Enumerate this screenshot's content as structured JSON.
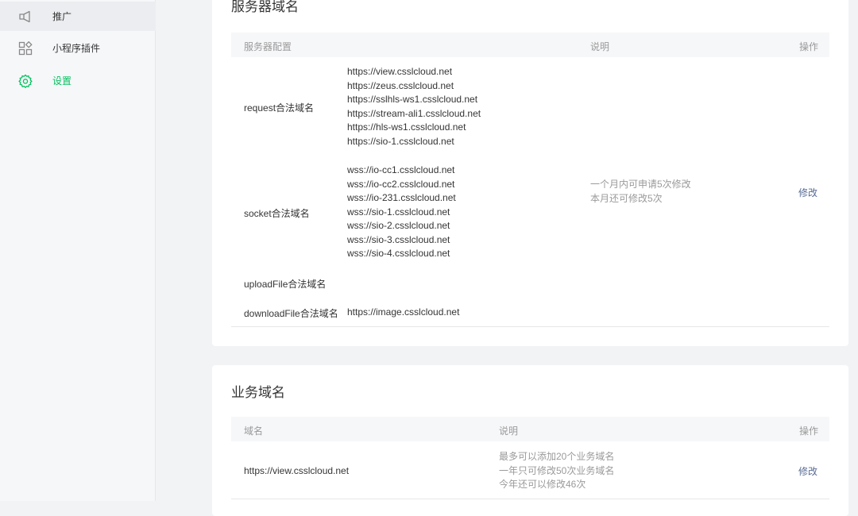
{
  "sidebar": {
    "items": [
      {
        "label": "推广",
        "icon": "megaphone-icon"
      },
      {
        "label": "小程序插件",
        "icon": "plugin-grid-icon"
      },
      {
        "label": "设置",
        "icon": "gear-icon"
      }
    ],
    "accent": "#07c160"
  },
  "server": {
    "title": "服务器域名",
    "headers": {
      "config": "服务器配置",
      "desc": "说明",
      "op": "操作"
    },
    "request": {
      "label": "request合法域名",
      "urls": [
        "https://view.csslcloud.net",
        "https://zeus.csslcloud.net",
        "https://sslhls-ws1.csslcloud.net",
        "https://stream-ali1.csslcloud.net",
        "https://hls-ws1.csslcloud.net",
        "https://sio-1.csslcloud.net"
      ]
    },
    "socket": {
      "label": "socket合法域名",
      "urls": [
        "wss://io-cc1.csslcloud.net",
        "wss://io-cc2.csslcloud.net",
        "wss://io-231.csslcloud.net",
        "wss://sio-1.csslcloud.net",
        "wss://sio-2.csslcloud.net",
        "wss://sio-3.csslcloud.net",
        "wss://sio-4.csslcloud.net"
      ]
    },
    "upload": {
      "label": "uploadFile合法域名"
    },
    "download": {
      "label": "downloadFile合法域名",
      "urls": [
        "https://image.csslcloud.net"
      ]
    },
    "notes": [
      "一个月内可申请5次修改",
      "本月还可修改5次"
    ],
    "op_label": "修改"
  },
  "business": {
    "title": "业务域名",
    "headers": {
      "domain": "域名",
      "desc": "说明",
      "op": "操作"
    },
    "row": {
      "domain": "https://view.csslcloud.net",
      "notes": [
        "最多可以添加20个业务域名",
        "一年只可修改50次业务域名",
        "今年还可以修改46次"
      ],
      "op_label": "修改"
    }
  }
}
